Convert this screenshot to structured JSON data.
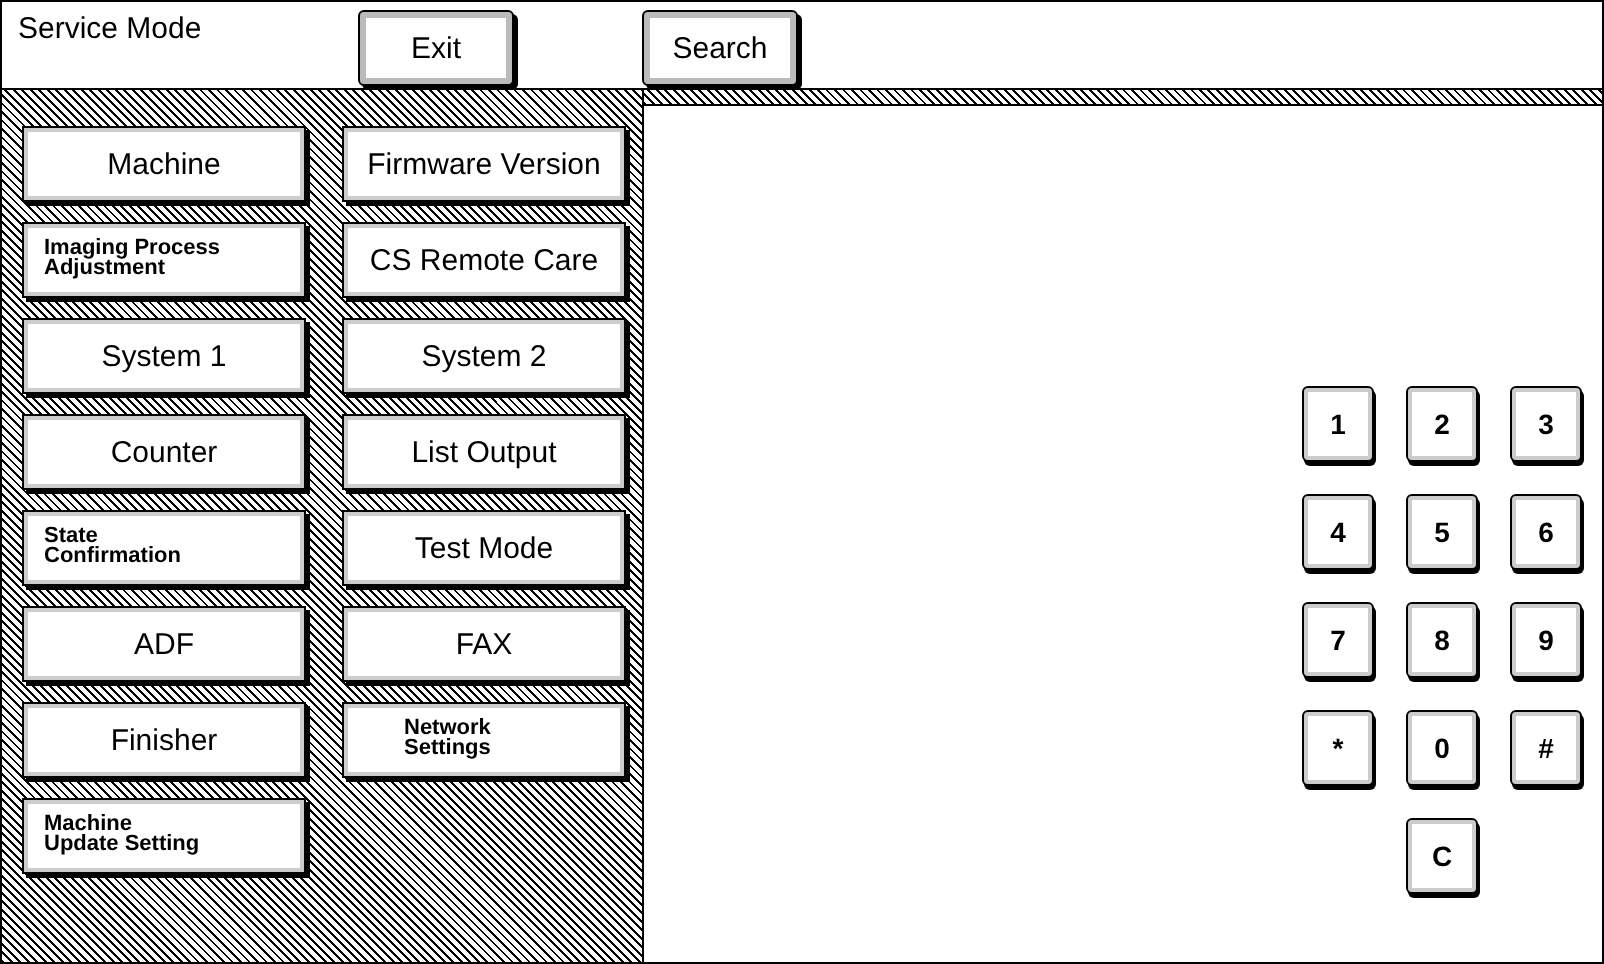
{
  "header": {
    "title": "Service Mode",
    "buttons": [
      "Exit",
      "Search"
    ]
  },
  "menu": [
    {
      "label": "Machine",
      "kind": "large"
    },
    {
      "label": "Firmware Version",
      "kind": "large"
    },
    {
      "label": "Imaging Process\nAdjustment",
      "kind": "small"
    },
    {
      "label": "CS Remote Care",
      "kind": "large"
    },
    {
      "label": "System 1",
      "kind": "large"
    },
    {
      "label": "System 2",
      "kind": "large"
    },
    {
      "label": "Counter",
      "kind": "large"
    },
    {
      "label": "List Output",
      "kind": "large"
    },
    {
      "label": "State\nConfirmation",
      "kind": "small"
    },
    {
      "label": "Test Mode",
      "kind": "large"
    },
    {
      "label": "ADF",
      "kind": "large"
    },
    {
      "label": "FAX",
      "kind": "large"
    },
    {
      "label": "Finisher",
      "kind": "large"
    },
    {
      "label": "Network\nSettings",
      "kind": "small"
    },
    {
      "label": "Machine\nUpdate Setting",
      "kind": "small"
    }
  ],
  "keypad": [
    "1",
    "2",
    "3",
    "4",
    "5",
    "6",
    "7",
    "8",
    "9",
    "*",
    "0",
    "#",
    "C"
  ]
}
